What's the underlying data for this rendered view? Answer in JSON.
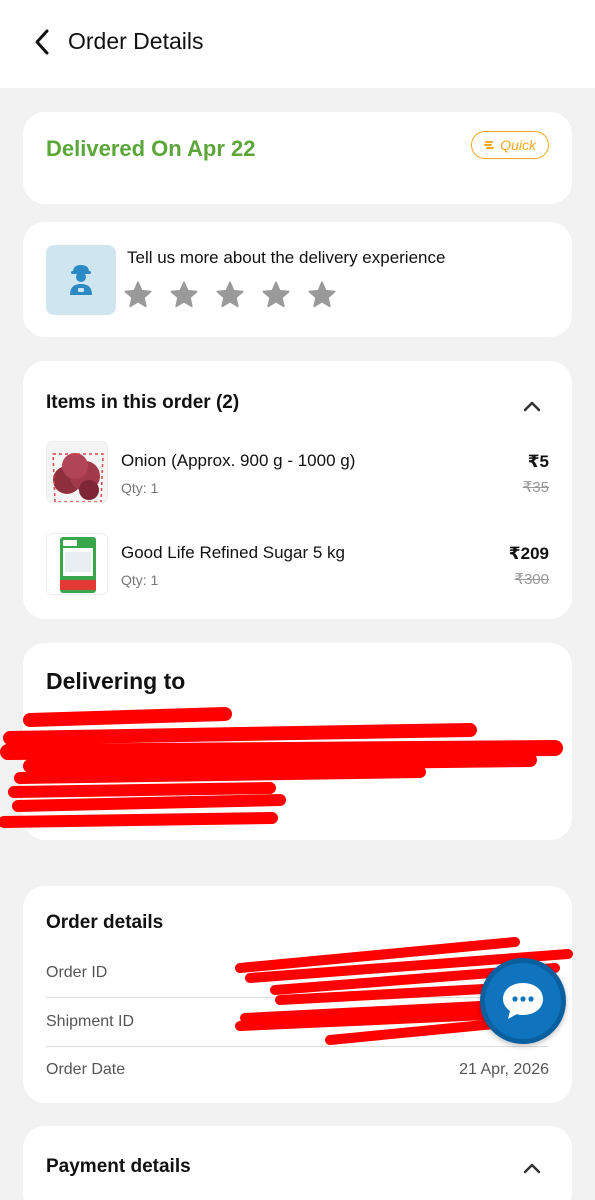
{
  "header": {
    "title": "Order Details"
  },
  "status": {
    "text": "Delivered On Apr 22",
    "badge": "Quick"
  },
  "feedback": {
    "prompt": "Tell us more about the delivery experience",
    "rating": 0,
    "max_rating": 5
  },
  "items_section": {
    "title": "Items in this order (2)",
    "items": [
      {
        "name": "Onion (Approx. 900 g - 1000 g)",
        "qty": "Qty: 1",
        "price": "₹5",
        "mrp": "₹35"
      },
      {
        "name": "Good Life Refined Sugar 5 kg",
        "qty": "Qty: 1",
        "price": "₹209",
        "mrp": "₹300"
      }
    ]
  },
  "delivery": {
    "title": "Delivering to"
  },
  "order_details": {
    "title": "Order details",
    "rows": [
      {
        "label": "Order ID",
        "value": ""
      },
      {
        "label": "Shipment ID",
        "value": ""
      },
      {
        "label": "Order Date",
        "value": "21 Apr, 2026"
      }
    ]
  },
  "payment": {
    "title": "Payment details"
  },
  "colors": {
    "accent_green": "#5ba639",
    "badge_orange": "#f0a71c",
    "chat_blue": "#0f74bd",
    "redaction_red": "#ff0000"
  }
}
